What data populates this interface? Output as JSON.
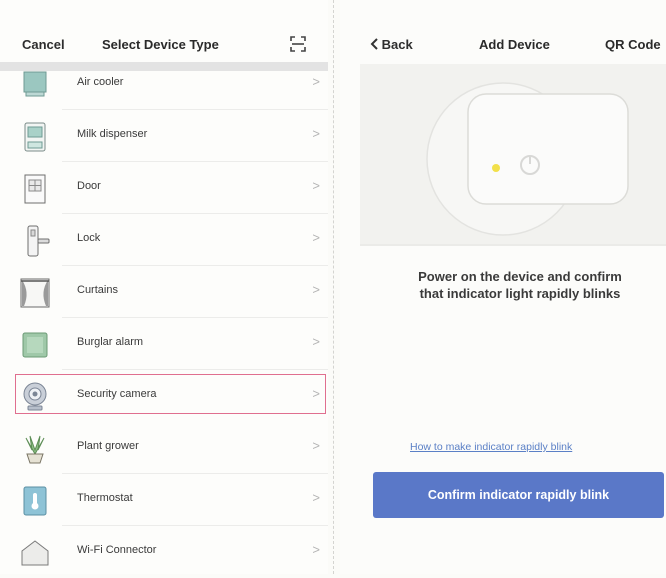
{
  "left": {
    "header": {
      "cancel_label": "Cancel",
      "title": "Select Device Type",
      "scan_icon": "scan-icon"
    },
    "items": [
      {
        "label": "Air cooler",
        "icon": "air-cooler-icon"
      },
      {
        "label": "Milk dispenser",
        "icon": "milk-dispenser-icon"
      },
      {
        "label": "Door",
        "icon": "door-icon"
      },
      {
        "label": "Lock",
        "icon": "lock-icon"
      },
      {
        "label": "Curtains",
        "icon": "curtains-icon"
      },
      {
        "label": "Burglar alarm",
        "icon": "burglar-alarm-icon"
      },
      {
        "label": "Security camera",
        "icon": "security-camera-icon",
        "selected": true
      },
      {
        "label": "Plant grower",
        "icon": "plant-grower-icon"
      },
      {
        "label": "Thermostat",
        "icon": "thermostat-icon"
      },
      {
        "label": "Wi-Fi Connector",
        "icon": "wifi-connector-icon"
      }
    ],
    "chevron": ">",
    "selected_border_color": "#e06f8f"
  },
  "right": {
    "header": {
      "back_label": "Back",
      "title": "Add Device",
      "qr_label": "QR Code"
    },
    "instruction_line1": "Power on the device and confirm",
    "instruction_line2": "that indicator light rapidly blinks",
    "help_link": "How to make indicator rapidly blink",
    "confirm_button": "Confirm indicator rapidly blink",
    "indicator_color": "#f2e04a",
    "accent_color": "#5a78c8"
  }
}
